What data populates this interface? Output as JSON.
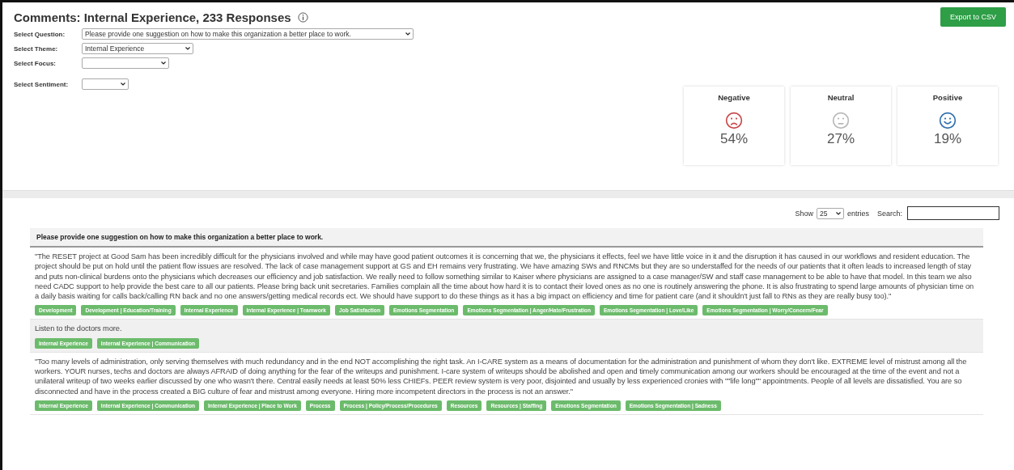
{
  "header": {
    "title": "Comments: Internal Experience, 233 Responses",
    "export_button": "Export to CSV"
  },
  "filters": [
    {
      "label": "Select Question:",
      "value": "Please provide one suggestion on how to make this organization a better place to work."
    },
    {
      "label": "Select Theme:",
      "value": "Internal Experience"
    },
    {
      "label": "Select Focus:"
    },
    {
      "label": "Select Sentiment:"
    }
  ],
  "sentiment_cards": [
    {
      "kind": "negative",
      "label": "Negative",
      "percent": "54%",
      "color": "#c9484a"
    },
    {
      "kind": "neutral",
      "label": "Neutral",
      "percent": "27%",
      "color": "#b8b8b8"
    },
    {
      "kind": "positive",
      "label": "Positive",
      "percent": "19%",
      "color": "#2f6fb0"
    }
  ],
  "table_controls": {
    "show_label": "Show",
    "page_size": "25",
    "entries_label": "entries",
    "search_label": "Search:"
  },
  "table": {
    "column_header": "Please provide one suggestion on how to make this organization a better place to work.",
    "rows": [
      {
        "text": "\"The RESET project at Good Sam has been incredibly difficult for the physicians involved and while may have good patient outcomes it is concerning that we, the physicians it effects, feel we have little voice in it and the disruption it has caused in our workflows and resident education. The project should be put on hold until the patient flow issues are resolved. The lack of case management support at GS and EH remains very frustrating. We have amazing SWs and RNCMs but they are so understaffed for the needs of our patients that it often leads to increased length of stay and puts non-clinical burdens onto the physicians which decreases our efficiency and job satisfaction. We really need to follow something similar to Kaiser where physicians are assigned to a case manager/SW and staff case management to be able to have that model. In this team we also need CADC support to help provide the best care to all our patients. Please bring back unit secretaries. Families complain all the time about how hard it is to contact their loved ones as no one is routinely answering the phone. It is also frustrating to spend large amounts of physician time on a daily basis waiting for calls back/calling RN back and no one answers/getting medical records ect. We should have support to do these things as it has a big impact on efficiency and time for patient care (and it shouldn't just fall to RNs as they are really busy too).\"",
        "tags": [
          "Development",
          "Development | Education/Training",
          "Internal Experience",
          "Internal Experience | Teamwork",
          "Job Satisfaction",
          "Emotions Segmentation",
          "Emotions Segmentation | Anger/Hate/Frustration",
          "Emotions Segmentation | Love/Like",
          "Emotions Segmentation | Worry/Concern/Fear"
        ]
      },
      {
        "text": "Listen to the doctors more.",
        "tags": [
          "Internal Experience",
          "Internal Experience | Communication"
        ]
      },
      {
        "text": "\"Too many levels of administration, only serving themselves with much redundancy and in the end NOT accomplishing the right task. An I-CARE system as a means of documentation for the administration and punishment of whom they don't like. EXTREME level of mistrust among all the workers. YOUR nurses, techs and doctors are always AFRAID of doing anything for the fear of the writeups and punishment. I-care system of writeups should be abolished and open and timely communication among our workers should be encouraged at the time of the event and not a unilateral writeup of two weeks earlier discussed by one who wasn't there. Central easily needs at least 50% less CHIEFs. PEER review system is very poor, disjointed and usually by less experienced cronies with \"\"life long\"\" appointments. People of all levels are dissatisfied. You are so disconnected and have in the process created a BIG culture of fear and mistrust among everyone. Hiring more incompetent directors in the process is not an answer.\"",
        "tags": [
          "Internal Experience",
          "Internal Experience | Communication",
          "Internal Experience | Place to Work",
          "Process",
          "Process | Policy/Process/Procedures",
          "Resources",
          "Resources | Staffing",
          "Emotions Segmentation",
          "Emotions Segmentation | Sadness"
        ]
      }
    ]
  }
}
